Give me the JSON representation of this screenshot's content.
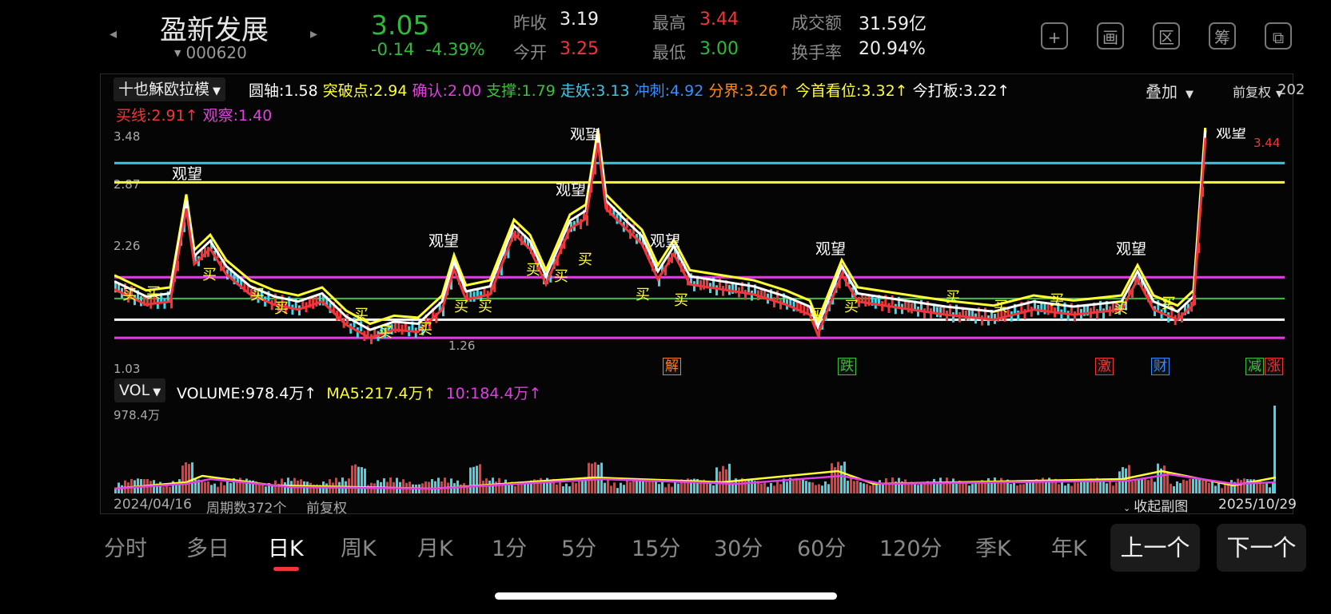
{
  "header": {
    "name": "盈新发展",
    "code": "000620",
    "price": "3.05",
    "change": "-0.14",
    "change_pct": "-4.39%",
    "prev_close_label": "昨收",
    "prev_close": "3.19",
    "open_label": "今开",
    "open": "3.25",
    "high_label": "最高",
    "high": "3.44",
    "low_label": "最低",
    "low": "3.00",
    "amount_label": "成交额",
    "amount": "31.59亿",
    "turnover_label": "换手率",
    "turnover": "20.94%",
    "icons": [
      "add-icon",
      "multi-chart-icon",
      "region-icon",
      "chip-icon",
      "share-icon"
    ],
    "icon_glyphs": [
      "+",
      "画",
      "区",
      "筹",
      "⧉"
    ]
  },
  "indicator": {
    "selector": "十也穌欧拉模",
    "items": [
      {
        "text": "圆轴:1.58",
        "color": "#ffffff"
      },
      {
        "text": "突破点:2.94",
        "color": "#ffff33"
      },
      {
        "text": "确认:2.00",
        "color": "#e040e0"
      },
      {
        "text": "支撑:1.79",
        "color": "#3fbf3f"
      },
      {
        "text": "走妖:3.13",
        "color": "#3fc6e6"
      },
      {
        "text": "冲刺:4.92",
        "color": "#3a8cff"
      },
      {
        "text": "分界:3.26↑",
        "color": "#ff8a1a"
      },
      {
        "text": "今首看位:3.32↑",
        "color": "#ffff33"
      },
      {
        "text": "今打板:3.22↑",
        "color": "#ffffff"
      }
    ],
    "items2": [
      {
        "text": "买线:2.91↑",
        "color": "#f0363a"
      },
      {
        "text": "观察:1.40",
        "color": "#e040e0"
      }
    ],
    "overlay": "叠加",
    "fq": "前复权",
    "year_cut": "202"
  },
  "kline": {
    "y_top": "3.48",
    "y_mid1": "2.87",
    "y_mid2": "2.26",
    "y_bottom": "1.03",
    "low_mark": "1.26",
    "high_mark": "3.44",
    "watch_label": "观望",
    "buy_label": "买",
    "signals": [
      {
        "text": "解",
        "color": "#ff7a1a"
      },
      {
        "text": "跌",
        "color": "#3fbf3f"
      },
      {
        "text": "激",
        "color": "#f0363a"
      },
      {
        "text": "财",
        "color": "#3a8cff"
      },
      {
        "text": "减",
        "color": "#3fbf3f"
      },
      {
        "text": "涨",
        "color": "#f0363a"
      }
    ]
  },
  "volume": {
    "selector": "VOL",
    "volume_text": "VOLUME:978.4万↑",
    "ma5_text": "MA5:217.4万↑",
    "ma10_text": "10:184.4万↑",
    "y_max": "978.4万"
  },
  "footer": {
    "start_date": "2024/04/16",
    "periods": "周期数372个",
    "fq": "前复权",
    "collapse": "收起副图",
    "end_date": "2025/10/29"
  },
  "tabs": [
    "分时",
    "多日",
    "日K",
    "周K",
    "月K",
    "1分",
    "5分",
    "15分",
    "30分",
    "60分",
    "120分",
    "季K",
    "年K"
  ],
  "active_tab": "日K",
  "prev_btn": "上一个",
  "next_btn": "下一个",
  "colors": {
    "up": "#f0363a",
    "down": "#2dbb3a",
    "accent_yellow": "#ffff33",
    "magenta": "#e040e0"
  }
}
